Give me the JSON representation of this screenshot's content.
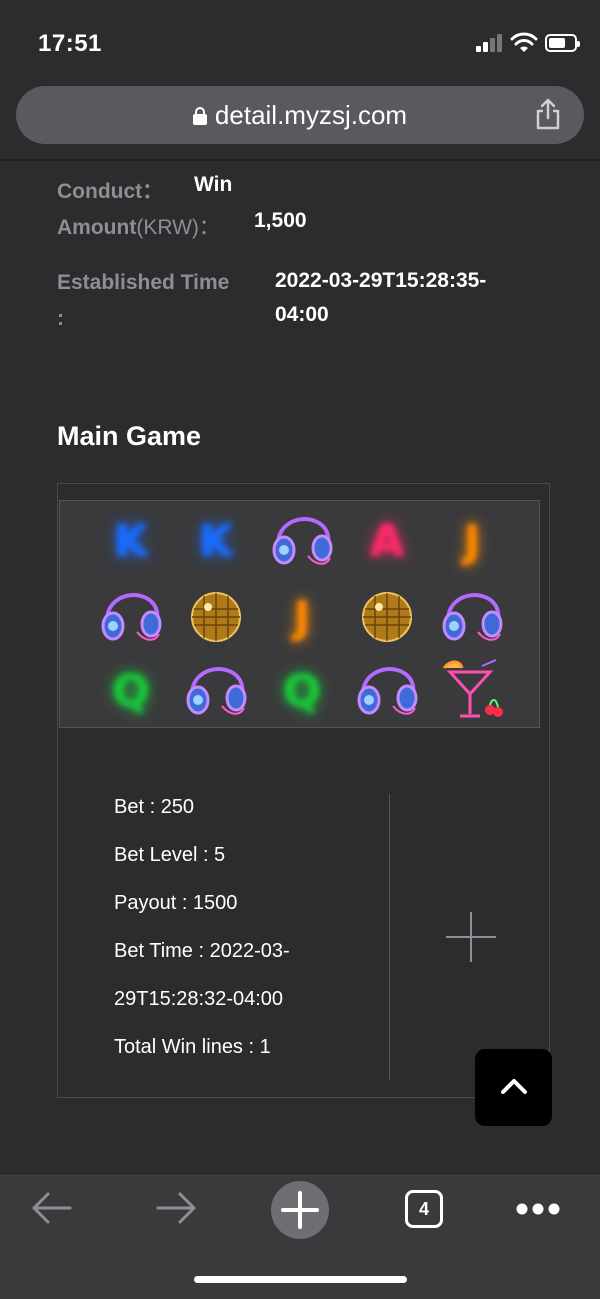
{
  "status_bar": {
    "time": "17:51"
  },
  "browser": {
    "url": "detail.myzsj.com",
    "tab_count": "4"
  },
  "info": {
    "conduct_label": "Conduct：",
    "conduct_value": "Win",
    "amount_label": "Amount",
    "amount_unit": "(KRW)：",
    "amount_value": "1,500",
    "established_label": "Established Time",
    "established_colon": ":",
    "established_value_line1": "2022-03-29T15:28:35-",
    "established_value_line2": "04:00"
  },
  "main_game": {
    "title": "Main Game",
    "reels": [
      [
        "K",
        "K",
        "headphones",
        "A",
        "J"
      ],
      [
        "headphones",
        "disco-ball",
        "J",
        "disco-ball",
        "headphones"
      ],
      [
        "Q",
        "headphones",
        "Q",
        "headphones",
        "cocktail"
      ]
    ],
    "details": {
      "bet": "Bet : 250",
      "bet_level": "Bet Level : 5",
      "payout": "Payout : 1500",
      "bet_time_line1": "Bet Time : 2022-03-",
      "bet_time_line2": "29T15:28:32-04:00",
      "total_win_lines": "Total Win lines : 1"
    }
  },
  "colors": {
    "background": "#2c2c2e",
    "label_gray": "#8e8e93",
    "neon_blue": "#49b8ff",
    "neon_red": "#ff4b5b",
    "neon_orange": "#ffb44a",
    "neon_green": "#5cff6a",
    "neon_purple": "#b36bff",
    "gold": "#d9a030"
  }
}
